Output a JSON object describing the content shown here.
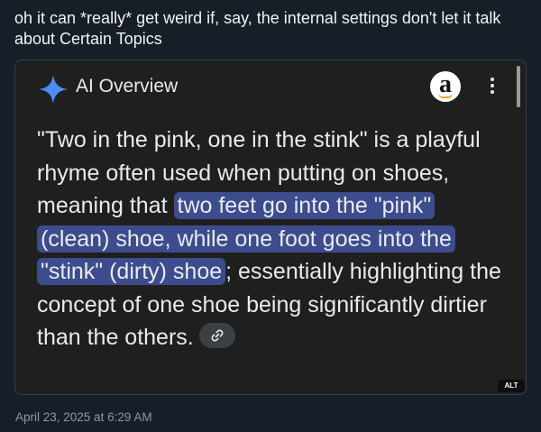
{
  "post": {
    "text": "oh it can *really* get weird if, say, the internal settings don't let it talk about Certain Topics",
    "timestamp": "April 23, 2025 at 6:29 AM"
  },
  "embed": {
    "header": {
      "title": "AI Overview",
      "sparkle_icon": "gemini-sparkle-icon",
      "avatar_letter": "a",
      "menu_icon": "more-vertical-icon"
    },
    "answer": {
      "before": "\"Two in the pink, one in the stink\" is a playful rhyme often used when putting on shoes, meaning that ",
      "highlight": "two feet go into the \"pink\" (clean) shoe, while one foot goes into the \"stink\" (dirty) shoe",
      "after": "; essentially highlighting the concept of one shoe being significantly dirtier than the others."
    },
    "alt_badge": "ALT"
  },
  "colors": {
    "page_background": "#161e27",
    "embed_background": "#1f1f1f",
    "highlight": "#3c4c8c",
    "sparkle": "#4c8df6",
    "muted_text": "#8b98a5"
  }
}
